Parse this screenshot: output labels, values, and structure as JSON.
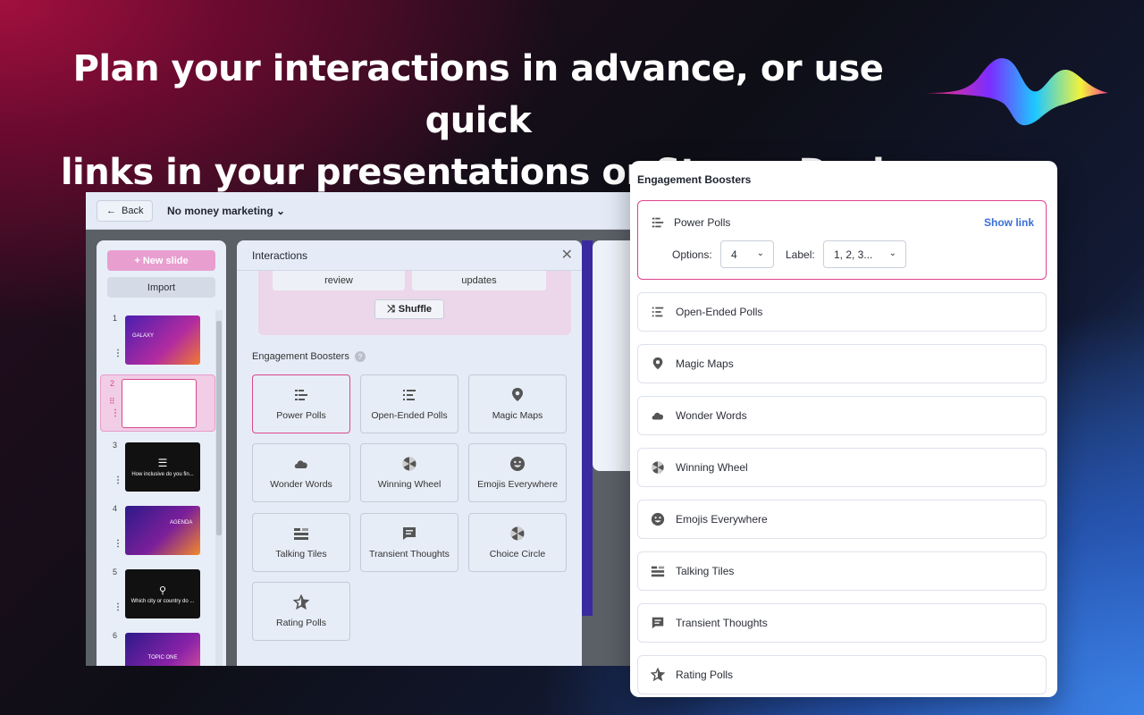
{
  "headline": {
    "line1": "Plan your interactions in advance, or use quick",
    "line2": "links in your presentations or StreamDeck"
  },
  "app": {
    "back_label": "Back",
    "presentation_title": "No money marketing",
    "new_slide_label": "+ New slide",
    "import_label": "Import",
    "slides": [
      {
        "num": "1",
        "text": "GALAXY"
      },
      {
        "num": "2",
        "text": ""
      },
      {
        "num": "3",
        "text": "How inclusive do you fin..."
      },
      {
        "num": "4",
        "text": "AGENDA"
      },
      {
        "num": "5",
        "text": "Which city or country do ..."
      },
      {
        "num": "6",
        "text": "TOPIC ONE"
      }
    ]
  },
  "interactions": {
    "title": "Interactions",
    "chips": [
      "review",
      "updates"
    ],
    "shuffle_label": "Shuffle",
    "section_label": "Engagement Boosters",
    "tiles": [
      {
        "label": "Power Polls",
        "icon": "poll-icon"
      },
      {
        "label": "Open-Ended Polls",
        "icon": "list-icon"
      },
      {
        "label": "Magic Maps",
        "icon": "map-pin-icon"
      },
      {
        "label": "Wonder Words",
        "icon": "cloud-icon"
      },
      {
        "label": "Winning Wheel",
        "icon": "wheel-icon"
      },
      {
        "label": "Emojis Everywhere",
        "icon": "smiley-icon"
      },
      {
        "label": "Talking Tiles",
        "icon": "tiles-icon"
      },
      {
        "label": "Transient Thoughts",
        "icon": "chat-icon"
      },
      {
        "label": "Choice Circle",
        "icon": "wheel-icon"
      },
      {
        "label": "Rating Polls",
        "icon": "star-icon"
      }
    ]
  },
  "panel": {
    "title": "Engagement Boosters",
    "expanded": {
      "label": "Power Polls",
      "show_link": "Show link",
      "options_label": "Options:",
      "options_value": "4",
      "label_label": "Label:",
      "label_value": "1, 2, 3..."
    },
    "items": [
      {
        "label": "Open-Ended Polls",
        "icon": "list-icon"
      },
      {
        "label": "Magic Maps",
        "icon": "map-pin-icon"
      },
      {
        "label": "Wonder Words",
        "icon": "cloud-icon"
      },
      {
        "label": "Winning Wheel",
        "icon": "wheel-icon"
      },
      {
        "label": "Emojis Everywhere",
        "icon": "smiley-icon"
      },
      {
        "label": "Talking Tiles",
        "icon": "tiles-icon"
      },
      {
        "label": "Transient Thoughts",
        "icon": "chat-icon"
      },
      {
        "label": "Rating Polls",
        "icon": "star-icon"
      }
    ]
  },
  "colors": {
    "accent_pink": "#e0418d",
    "link_blue": "#3a6fd8"
  }
}
